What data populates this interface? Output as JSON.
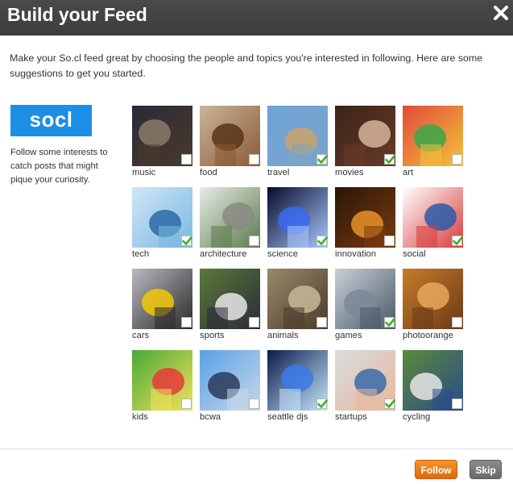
{
  "dialog": {
    "title": "Build your Feed",
    "close_icon": "close-x-icon",
    "intro": "Make your So.cl feed great by choosing the people and topics you're interested in following. Here are some suggestions to get you started."
  },
  "sidebar": {
    "logo_text": "socl",
    "logo_color": "#1b8ee5",
    "description": "Follow some interests to catch posts that might pique your curiosity."
  },
  "topics": [
    {
      "label": "music",
      "checked": false,
      "colors": [
        "#2a2a3a",
        "#8a7a6a",
        "#4a3a2a"
      ]
    },
    {
      "label": "food",
      "checked": false,
      "colors": [
        "#c9b49a",
        "#5a3418",
        "#8a5a32"
      ]
    },
    {
      "label": "travel",
      "checked": true,
      "colors": [
        "#6fa3d8",
        "#c9a36a",
        "#7aa4c8"
      ]
    },
    {
      "label": "movies",
      "checked": true,
      "colors": [
        "#3a2418",
        "#d8b49a",
        "#6a3a28"
      ]
    },
    {
      "label": "art",
      "checked": false,
      "colors": [
        "#e24a3a",
        "#3aa84a",
        "#f2c23a"
      ]
    },
    {
      "label": "tech",
      "checked": true,
      "colors": [
        "#cfe6f6",
        "#2a6aa8",
        "#7ab8e0"
      ]
    },
    {
      "label": "architecture",
      "checked": false,
      "colors": [
        "#e8ece8",
        "#8a8a82",
        "#5a7a4a"
      ]
    },
    {
      "label": "science",
      "checked": true,
      "colors": [
        "#060a2a",
        "#3a6af2",
        "#a8c8ff"
      ]
    },
    {
      "label": "innovation",
      "checked": false,
      "colors": [
        "#2a1608",
        "#e8922a",
        "#7a3a10"
      ]
    },
    {
      "label": "social",
      "checked": true,
      "colors": [
        "#ffffff",
        "#2a5aa8",
        "#d83a3a"
      ]
    },
    {
      "label": "cars",
      "checked": false,
      "colors": [
        "#b8b8c0",
        "#f2c80a",
        "#2a2a2a"
      ]
    },
    {
      "label": "sports",
      "checked": false,
      "colors": [
        "#5a7a3a",
        "#e8e8e8",
        "#2a2a3a"
      ]
    },
    {
      "label": "animals",
      "checked": false,
      "colors": [
        "#9a8a6a",
        "#c8b89a",
        "#4a3a2a"
      ]
    },
    {
      "label": "games",
      "checked": true,
      "colors": [
        "#c8d0d8",
        "#7a8a98",
        "#4a5a68"
      ]
    },
    {
      "label": "photoorange",
      "checked": false,
      "colors": [
        "#c87a2a",
        "#e8a85a",
        "#6a3a18"
      ]
    },
    {
      "label": "kids",
      "checked": false,
      "colors": [
        "#4aa83a",
        "#e83a3a",
        "#f2e25a"
      ]
    },
    {
      "label": "bcwa",
      "checked": false,
      "colors": [
        "#5aa0e8",
        "#2a3a5a",
        "#c8d8e8"
      ]
    },
    {
      "label": "seattle djs",
      "checked": true,
      "colors": [
        "#0a1a4a",
        "#3a7ae8",
        "#c8e8ff"
      ]
    },
    {
      "label": "startups",
      "checked": true,
      "colors": [
        "#d8dce0",
        "#3a6aa8",
        "#e8b89a"
      ]
    },
    {
      "label": "cycling",
      "checked": false,
      "colors": [
        "#5a8a3a",
        "#e8e8e8",
        "#2a4a8a"
      ]
    }
  ],
  "footer": {
    "follow_label": "Follow",
    "skip_label": "Skip",
    "follow_color": "#f0831c",
    "skip_color": "#7a7a7a"
  }
}
